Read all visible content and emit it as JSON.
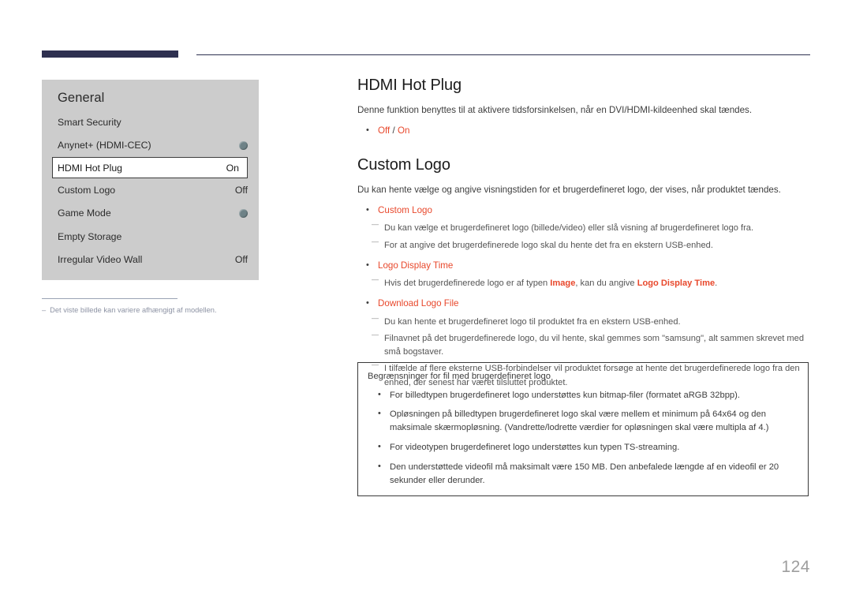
{
  "header": {
    "tab_bar_color": "#2e3050",
    "rule_color": "#2e3050"
  },
  "accent_color": "#e8482c",
  "menu_panel": {
    "title": "General",
    "items": [
      {
        "label": "Smart Security",
        "value": "",
        "control": "none"
      },
      {
        "label": "Anynet+ (HDMI-CEC)",
        "value": "",
        "control": "dot"
      },
      {
        "label": "HDMI Hot Plug",
        "value": "On",
        "control": "value",
        "selected": true
      },
      {
        "label": "Custom Logo",
        "value": "Off",
        "control": "value"
      },
      {
        "label": "Game Mode",
        "value": "",
        "control": "dot"
      },
      {
        "label": "Empty Storage",
        "value": "",
        "control": "none"
      },
      {
        "label": "Irregular Video Wall",
        "value": "Off",
        "control": "value"
      }
    ],
    "footnote_dash": "–",
    "footnote": "Det viste billede kan variere afhængigt af modellen."
  },
  "content": {
    "section1": {
      "heading": "HDMI Hot Plug",
      "intro": "Denne funktion benyttes til at aktivere tidsforsinkelsen, når en DVI/HDMI-kildeenhed skal tændes.",
      "bullet_off": "Off",
      "bullet_sep": " / ",
      "bullet_on": "On"
    },
    "section2": {
      "heading": "Custom Logo",
      "intro": "Du kan hente vælge og angive visningstiden for et brugerdefineret logo, der vises, når produktet tændes.",
      "bullet1": "Custom Logo",
      "sub1a": "Du kan vælge et brugerdefineret logo (billede/video) eller slå visning af brugerdefineret logo fra.",
      "sub1b": "For at angive det brugerdefinerede logo skal du hente det fra en ekstern USB-enhed.",
      "bullet2": "Logo Display Time",
      "sub2a_pre": "Hvis det brugerdefinerede logo er af typen ",
      "sub2a_accent1": "Image",
      "sub2a_mid": ", kan du angive ",
      "sub2a_accent2": "Logo Display Time",
      "sub2a_post": ".",
      "bullet3": "Download Logo File",
      "sub3a": "Du kan hente et brugerdefineret logo til produktet fra en ekstern USB-enhed.",
      "sub3b": "Filnavnet på det brugerdefinerede logo, du vil hente, skal gemmes som \"samsung\", alt sammen skrevet med små bogstaver.",
      "sub3c": "I tilfælde af flere eksterne USB-forbindelser vil produktet forsøge at hente det brugerdefinerede logo fra den enhed, der senest har været tilsluttet produktet."
    }
  },
  "note_box": {
    "title": "Begrænsninger for fil med brugerdefineret logo",
    "items": [
      "For billedtypen brugerdefineret logo understøttes kun bitmap-filer (formatet aRGB 32bpp).",
      "Opløsningen på billedtypen brugerdefineret logo skal være mellem et minimum på 64x64 og den maksimale skærmopløsning. (Vandrette/lodrette værdier for opløsningen skal være multipla af 4.)",
      "For videotypen brugerdefineret logo understøttes kun typen TS-streaming.",
      "Den understøttede videofil må maksimalt være 150 MB. Den anbefalede længde af en videofil er 20 sekunder eller derunder."
    ]
  },
  "page_number": "124"
}
